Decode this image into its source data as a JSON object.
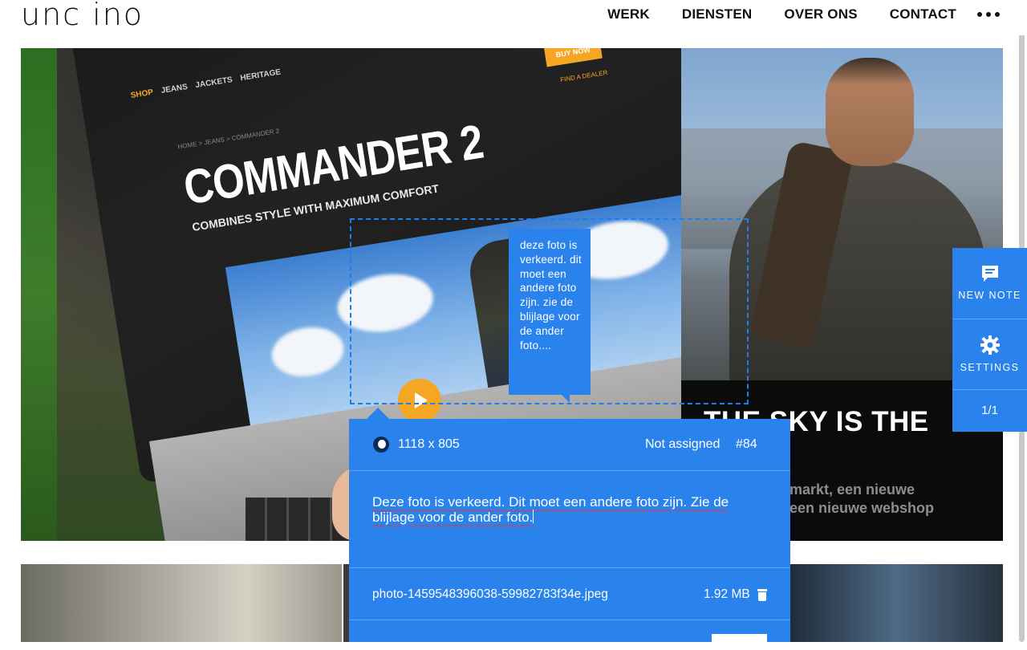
{
  "site": {
    "logo_text": "unc ino",
    "nav": [
      "WERK",
      "DIENSTEN",
      "OVER ONS",
      "CONTACT"
    ],
    "more_icon": "ellipsis-icon"
  },
  "laptop_screen": {
    "nav_items": [
      "SHOP",
      "JEANS",
      "JACKETS",
      "HERITAGE"
    ],
    "crumbs": "HOME > JEANS > COMMANDER 2",
    "headline": "COMMANDER 2",
    "subhead": "COMBINES STYLE WITH MAXIMUM COMFORT",
    "buy_button": "BUY NOW",
    "dealer_link": "FIND A DEALER"
  },
  "case_tile": {
    "title": "THE SKY IS THE",
    "subtitle_lines": [
      "markt, een nieuwe",
      "een nieuwe webshop"
    ]
  },
  "annotation": {
    "bubble_text": "deze foto is verkeerd. dit moet een andere foto zijn. zie de blijlage voor de ander foto....",
    "dimensions": "1118 x 805",
    "assignee": "Not assigned",
    "number": "#84",
    "comment": "Deze foto is verkeerd. Dit moet een andere foto zijn. Zie de blijlage voor de ander foto.",
    "attachment_name": "photo-1459548396038-59982783f34e.jpeg",
    "attachment_size": "1.92 MB",
    "accent_color": "#2a83ec"
  },
  "toolbar": {
    "new_note": "NEW NOTE",
    "settings": "SETTINGS",
    "pager": "1/1"
  }
}
